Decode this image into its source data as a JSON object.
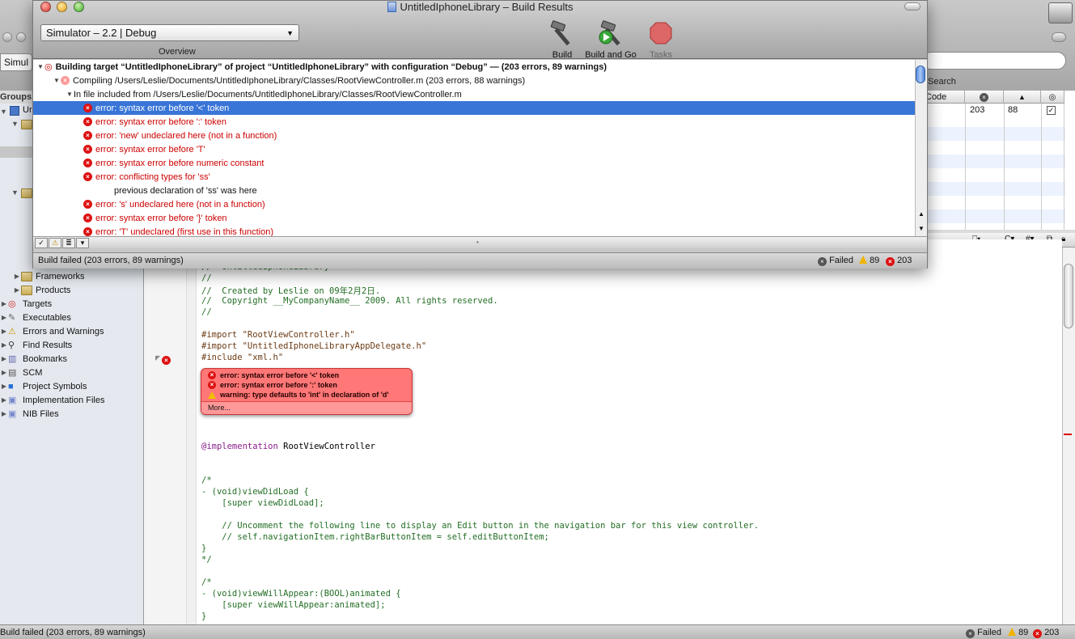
{
  "background_window": {
    "toolbar_partial_label": "Simul",
    "groups_label": "Groups &",
    "search_label": "Search",
    "sidebar_items": [
      {
        "label": "Frameworks",
        "icon": "folder-icon"
      },
      {
        "label": "Products",
        "icon": "folder-icon"
      },
      {
        "label": "Targets",
        "icon": "target-icon"
      },
      {
        "label": "Executables",
        "icon": "executable-icon"
      },
      {
        "label": "Errors and Warnings",
        "icon": "warning-icon"
      },
      {
        "label": "Find Results",
        "icon": "magnifier-icon"
      },
      {
        "label": "Bookmarks",
        "icon": "bookmark-icon"
      },
      {
        "label": "SCM",
        "icon": "scm-icon"
      },
      {
        "label": "Project Symbols",
        "icon": "cube-icon"
      },
      {
        "label": "Implementation Files",
        "icon": "smart-group-icon"
      },
      {
        "label": "NIB Files",
        "icon": "smart-group-icon"
      }
    ],
    "grid": {
      "col_code": "Code",
      "errors": "203",
      "warnings": "88"
    },
    "editor_lines": [
      {
        "text": "//  UntitledIphoneLibrary",
        "cls": "c-com"
      },
      {
        "text": "//",
        "cls": "c-com"
      },
      {
        "text": "//  Created by Leslie on 09年2月2日.",
        "cls": "c-com"
      },
      {
        "text": "//  Copyright __MyCompanyName__ 2009. All rights reserved.",
        "cls": "c-com"
      },
      {
        "text": "//",
        "cls": "c-com"
      },
      {
        "text": "",
        "cls": ""
      },
      {
        "text": "#import \"RootViewController.h\"",
        "cls": "c-pre"
      },
      {
        "text": "#import \"UntitledIphoneLibraryAppDelegate.h\"",
        "cls": "c-pre"
      },
      {
        "text": "#include \"xml.h\"",
        "cls": "c-pre"
      }
    ],
    "editor_lines_lower": [
      {
        "text": "@implementation RootViewController",
        "cls": ""
      },
      {
        "text": "",
        "cls": ""
      },
      {
        "text": "",
        "cls": ""
      },
      {
        "text": "/*",
        "cls": "c-com"
      },
      {
        "text": "- (void)viewDidLoad {",
        "cls": "c-com"
      },
      {
        "text": "    [super viewDidLoad];",
        "cls": "c-com"
      },
      {
        "text": "",
        "cls": ""
      },
      {
        "text": "    // Uncomment the following line to display an Edit button in the navigation bar for this view controller.",
        "cls": "c-com"
      },
      {
        "text": "    // self.navigationItem.rightBarButtonItem = self.editButtonItem;",
        "cls": "c-com"
      },
      {
        "text": "}",
        "cls": "c-com"
      },
      {
        "text": "*/",
        "cls": "c-com"
      },
      {
        "text": "",
        "cls": ""
      },
      {
        "text": "/*",
        "cls": "c-com"
      },
      {
        "text": "- (void)viewWillAppear:(BOOL)animated {",
        "cls": "c-com"
      },
      {
        "text": "    [super viewWillAppear:animated];",
        "cls": "c-com"
      },
      {
        "text": "}",
        "cls": "c-com"
      }
    ],
    "bubble": {
      "items": [
        {
          "kind": "error",
          "text": "error: syntax error before '<' token"
        },
        {
          "kind": "error",
          "text": "error: syntax error before ':' token"
        },
        {
          "kind": "warning",
          "text": "warning: type defaults to 'int' in declaration of 'd'"
        }
      ],
      "more_label": "More..."
    },
    "bottom_status": "Build failed (203 errors, 89 warnings)",
    "bottom_failed": "Failed",
    "bottom_warnings": "89",
    "bottom_errors": "203"
  },
  "build_results": {
    "title": "UntitledIphoneLibrary – Build Results",
    "config_select": "Simulator – 2.2 | Debug",
    "overview_label": "Overview",
    "toolbar": {
      "build_label": "Build",
      "build_and_go_label": "Build and Go",
      "tasks_label": "Tasks"
    },
    "rows": [
      {
        "level": 0,
        "kind": "target",
        "text": "Building target “UntitledIphoneLibrary” of project “UntitledIphoneLibrary” with configuration “Debug” — (203 errors, 89 warnings)",
        "bold": true
      },
      {
        "level": 1,
        "kind": "compile",
        "text": "Compiling /Users/Leslie/Documents/UntitledIphoneLibrary/Classes/RootViewController.m (203 errors, 88 warnings)"
      },
      {
        "level": 2,
        "kind": "include",
        "text": "In file included from /Users/Leslie/Documents/UntitledIphoneLibrary/Classes/RootViewController.m"
      },
      {
        "level": 3,
        "kind": "error",
        "text": "error: syntax error before '<' token",
        "selected": true
      },
      {
        "level": 3,
        "kind": "error",
        "text": "error: syntax error before ':' token"
      },
      {
        "level": 3,
        "kind": "error",
        "text": "error: 'new' undeclared here (not in a function)"
      },
      {
        "level": 3,
        "kind": "error",
        "text": "error: syntax error before 'T'"
      },
      {
        "level": 3,
        "kind": "error",
        "text": "error: syntax error before numeric constant"
      },
      {
        "level": 3,
        "kind": "error",
        "text": "error: conflicting types for 'ss'"
      },
      {
        "level": 4,
        "kind": "note",
        "text": "previous declaration of 'ss' was here"
      },
      {
        "level": 3,
        "kind": "error",
        "text": "error: 's' undeclared here (not in a function)"
      },
      {
        "level": 3,
        "kind": "error",
        "text": "error: syntax error before '}' token"
      },
      {
        "level": 3,
        "kind": "error",
        "text": "error: 'T' undeclared (first use in this function)"
      }
    ],
    "status": "Build failed (203 errors, 89 warnings)",
    "status_failed": "Failed",
    "status_warnings": "89",
    "status_errors": "203"
  },
  "colors": {
    "selection": "#3875d7",
    "error_text": "#cc0000",
    "bubble": "#ff7777"
  }
}
